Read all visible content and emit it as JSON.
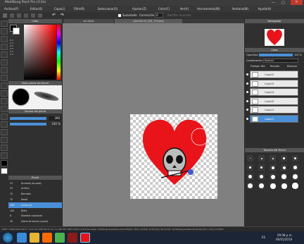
{
  "window": {
    "title": "MediBang Paint Pro (3.0a)"
  },
  "menu": [
    "Archivo(F)",
    "Editar(E)",
    "Capa(L)",
    "Filtro(R)",
    "Seleccionar(S)",
    "Ajustar(Z)",
    "Color(C)",
    "Ver(V)",
    "Herramienta(W)",
    "Ventana(W)",
    "Ayuda(H)"
  ],
  "toolbar": {
    "antialias": "Suavizado",
    "correction_label": "Corrección",
    "correction_value": "0",
    "stabilizer": "Rechter Suavizar"
  },
  "tabs": [
    "sin título",
    "cool-00-05_1b0_729.png"
  ],
  "panels": {
    "color": "Color",
    "brush_preview": "Vista previa del pincel",
    "brush_control": "Control del pincel",
    "brush": "Pincel",
    "navigator": "Navegador",
    "layer": "Capa",
    "brush_size": "Tamaño del Pincel"
  },
  "color_values": {
    "r": "0",
    "g": "0",
    "b": "0",
    "h": "0",
    "s": "0",
    "v": "0"
  },
  "brush_control": {
    "size": "288",
    "opacity": "100 %"
  },
  "brushes": [
    {
      "size": "23",
      "name": "Acuarela (acuosa)"
    },
    {
      "size": "25",
      "name": "Acrílico"
    },
    {
      "size": "70",
      "name": "Borrador"
    },
    {
      "size": "70",
      "name": "Desfo"
    },
    {
      "size": "288",
      "name": "Aerógrafo"
    },
    {
      "size": "100",
      "name": "Brillo"
    },
    {
      "size": "8",
      "name": "Simetría rotacional"
    },
    {
      "size": "30",
      "name": "Goma de borrar (suave)"
    }
  ],
  "layer_panel": {
    "opacity_label": "Opacidad",
    "opacity_value": "100 %",
    "blend_label": "Combinación",
    "blend_value": "Normal",
    "protect": "Proteger alfa",
    "clip": "Recortar",
    "lock": "Bloquear"
  },
  "layers": [
    "Capa12",
    "Capa13",
    "Capa14",
    "Capa15",
    "Capa11",
    "Capa17"
  ],
  "status_bar": {
    "text": "1500 * 1500 pixel (12,5 * 12,5 cm) 300 dpi 21 % ( 1,1 28, 83 ) Para trazar una línea recta, mantenga pulsada la tecla Mayús. Para cambiar el tamaño del pincel, mantenga pulsada las teclas Ctrl + Alt y arrastre"
  },
  "taskbar": {
    "time": "09:08 p.m.",
    "date": "06/01/2019",
    "lang": "ES"
  },
  "colors": {
    "heart": "#e8141a",
    "accent": "#4a90d9",
    "bg": "#2b2b2b"
  }
}
